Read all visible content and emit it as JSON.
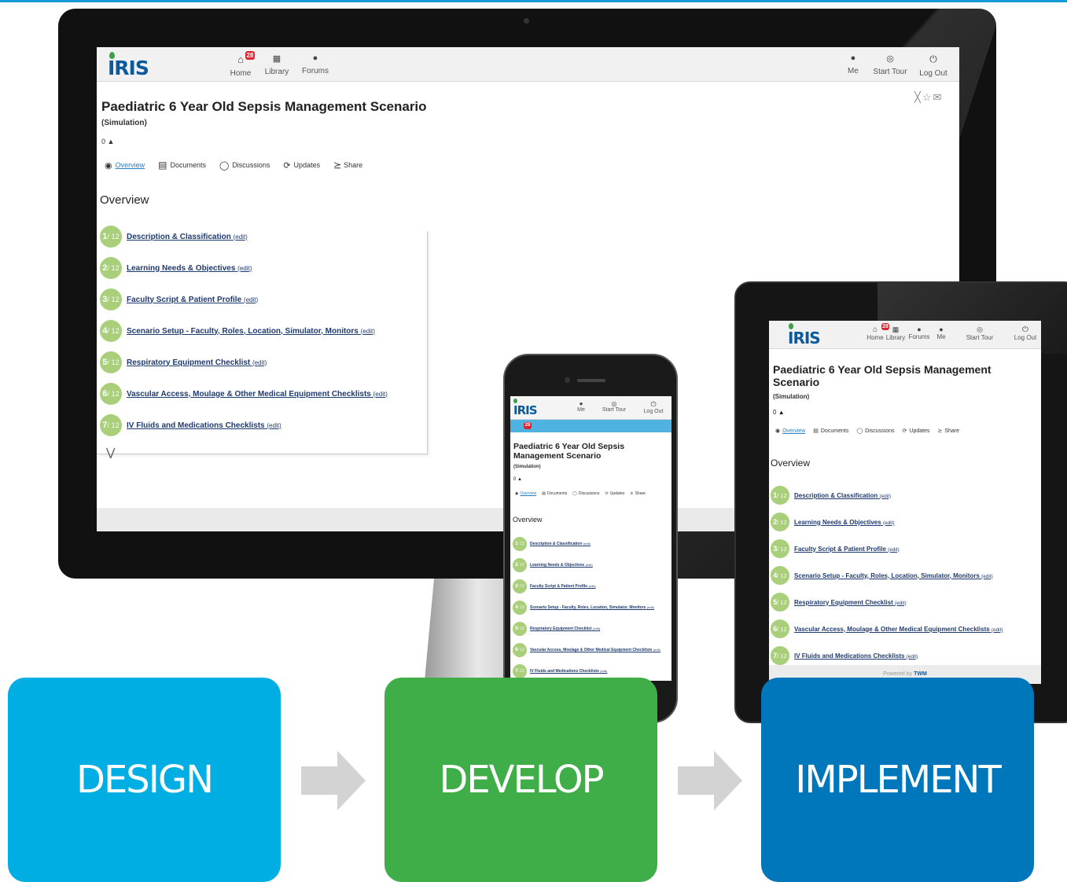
{
  "app": {
    "logo": "IRIS",
    "nav_left": [
      {
        "label": "Home",
        "icon": "home-icon",
        "badge": "28"
      },
      {
        "label": "Library",
        "icon": "library-icon"
      },
      {
        "label": "Forums",
        "icon": "forums-icon"
      }
    ],
    "nav_right": [
      {
        "label": "Me",
        "icon": "user-icon"
      },
      {
        "label": "Start Tour",
        "icon": "tour-icon"
      },
      {
        "label": "Log Out",
        "icon": "power-icon"
      }
    ],
    "page_title": "Paediatric 6 Year Old Sepsis Management Scenario",
    "page_subtitle": "(Simulation)",
    "likes": "0",
    "tabs": [
      "Overview",
      "Documents",
      "Discussions",
      "Updates",
      "Share"
    ],
    "overview_heading": "Overview",
    "steps_total": "12",
    "edit_label": "(edit)",
    "steps": [
      {
        "num": "1",
        "label": "Description & Classification"
      },
      {
        "num": "2",
        "label": "Learning Needs & Objectives"
      },
      {
        "num": "3",
        "label": "Faculty Script & Patient Profile"
      },
      {
        "num": "4",
        "label": "Scenario Setup - Faculty, Roles, Location, Simulator, Monitors"
      },
      {
        "num": "5",
        "label": "Respiratory Equipment Checklist"
      },
      {
        "num": "6",
        "label": "Vascular Access, Moulage & Other Medical Equipment Checklists"
      },
      {
        "num": "7",
        "label": "IV Fluids and Medications Checklists"
      }
    ],
    "powered_by": "Powered by",
    "powered_brand": "TWM",
    "colors": {
      "logo": "#0b5b9c",
      "step_circle": "#a9cf7a",
      "badge": "#d9232d",
      "phone_bar": "#4fb2e1"
    }
  },
  "stages": [
    {
      "label": "DESIGN",
      "color": "#00aee4"
    },
    {
      "label": "DEVELOP",
      "color": "#3fae49"
    },
    {
      "label": "IMPLEMENT",
      "color": "#0077bb"
    }
  ]
}
